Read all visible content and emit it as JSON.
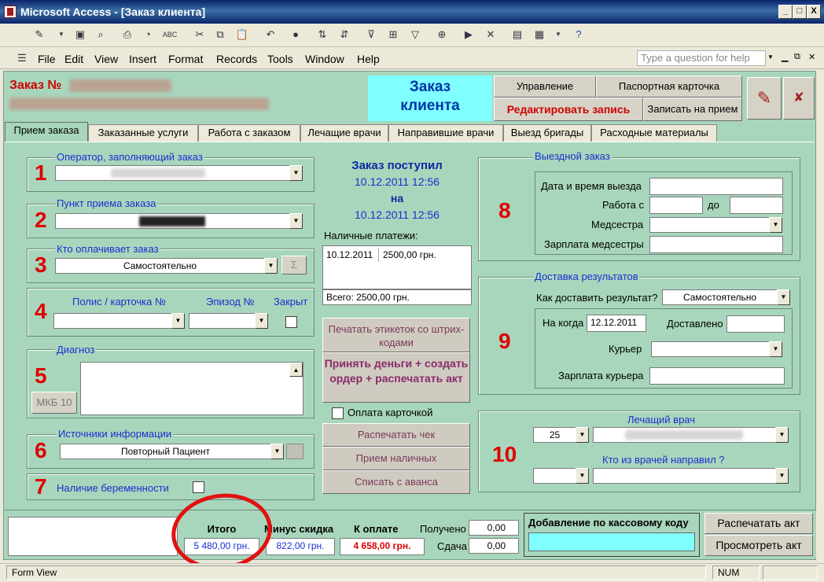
{
  "window": {
    "title": "Microsoft Access - [Заказ клиента]",
    "controls": [
      "_",
      "□",
      "X"
    ]
  },
  "toolbar": {
    "icons": [
      "design-view-icon",
      "save-icon",
      "file-search-icon",
      "print-icon",
      "print-preview-icon",
      "spelling-icon",
      "cut-icon",
      "copy-icon",
      "paste-icon",
      "undo-icon",
      "hyperlink-icon",
      "sort-ascending-icon",
      "sort-descending-icon",
      "filter-by-selection-icon",
      "filter-by-form-icon",
      "apply-filter-icon",
      "find-icon",
      "new-record-icon",
      "delete-record-icon",
      "database-window-icon",
      "new-object-icon",
      "help-icon"
    ]
  },
  "menubar": {
    "items": [
      "File",
      "Edit",
      "View",
      "Insert",
      "Format",
      "Records",
      "Tools",
      "Window",
      "Help"
    ],
    "help_placeholder": "Type a question for help"
  },
  "header": {
    "order_label": "Заказ №",
    "title_line1": "Заказ",
    "title_line2": "клиента",
    "buttons": {
      "manage": "Управление",
      "passport": "Паспортная карточка",
      "edit": "Редактировать запись",
      "appointment": "Записать на прием"
    }
  },
  "tabs": [
    "Прием заказа",
    "Заказанные услуги",
    "Работа с заказом",
    "Лечащие врачи",
    "Направившие врачи",
    "Выезд бригады",
    "Расходные материалы"
  ],
  "sections": {
    "operator": {
      "label": "Оператор, заполняющий заказ",
      "num": "1"
    },
    "point": {
      "label": "Пункт приема заказа",
      "num": "2"
    },
    "payer": {
      "label": "Кто оплачивает заказ",
      "num": "3",
      "value": "Самостоятельно",
      "sigma": "Σ"
    },
    "policy": {
      "num": "4",
      "policy_label": "Полис / карточка №",
      "episode_label": "Эпизод №",
      "closed_label": "Закрыт"
    },
    "diagnosis": {
      "label": "Диагноз",
      "num": "5",
      "mkb": "МКБ 10"
    },
    "sources": {
      "label": "Источники информации",
      "num": "6",
      "value": "Повторный Пациент"
    },
    "pregnancy": {
      "label": "Наличие беременности",
      "num": "7"
    },
    "visit": {
      "label": "Выездной заказ",
      "num": "8",
      "datetime": "Дата и время выезда",
      "work_from": "Работа с",
      "to": "до",
      "nurse": "Медсестра",
      "nurse_salary": "Зарплата медсестры"
    },
    "delivery": {
      "label": "Доставка результатов",
      "num": "9",
      "how": "Как доставить результат?",
      "how_value": "Самостоятельно",
      "when": "На когда",
      "when_value": "12.12.2011",
      "delivered": "Доставлено",
      "courier": "Курьер",
      "courier_salary": "Зарплата курьера"
    },
    "doctor": {
      "label": "Лечащий врач",
      "num": "10",
      "code": "25",
      "who_referred": "Кто из врачей направил ?"
    }
  },
  "order_status": {
    "received": "Заказ поступил",
    "date1": "10.12.2011 12:56",
    "on": "на",
    "date2": "10.12.2011 12:56"
  },
  "payments": {
    "label": "Наличные платежи:",
    "rows": [
      {
        "date": "10.12.2011",
        "amount": "2500,00 грн."
      }
    ],
    "total": "Всего: 2500,00 грн."
  },
  "actions": {
    "print_labels": "Печатать этикеток со штрих-кодами",
    "accept_money": "Принять деньги + создать ордер + распечатать акт",
    "card_payment": "Оплата карточкой",
    "print_check": "Распечатать чек",
    "cash_receipt": "Прием наличных",
    "write_off": "Списать с аванса"
  },
  "totals": {
    "total_label": "Итого",
    "total_value": "5 480,00 грн.",
    "discount_label": "Минус скидка",
    "discount_value": "822,00 грн.",
    "pay_label": "К оплате",
    "pay_value": "4 658,00 грн.",
    "received_label": "Получено",
    "received_value": "0,00",
    "change_label": "Сдача",
    "change_value": "0,00",
    "cash_code_label": "Добавление по кассовому коду",
    "print_act": "Распечатать акт",
    "view_act": "Просмотреть акт"
  },
  "status": {
    "view": "Form View",
    "num": "NUM"
  }
}
